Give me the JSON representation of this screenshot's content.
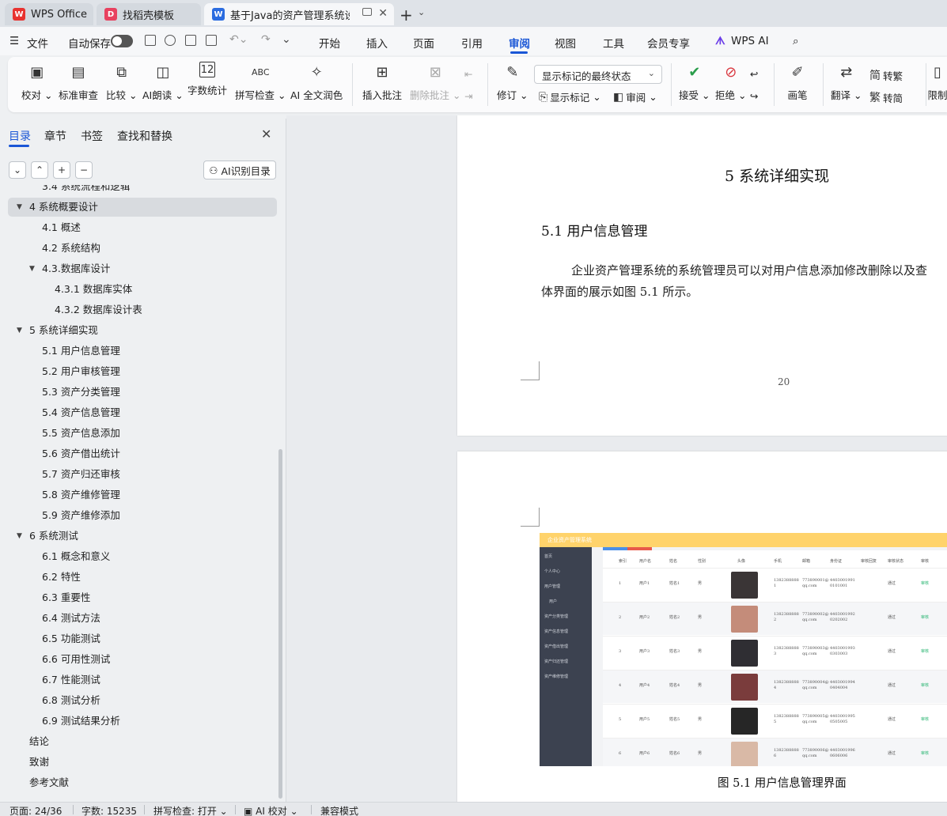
{
  "tabs": [
    {
      "label": "WPS Office",
      "icon": "wps-logo-icon",
      "color": "#e8322f"
    },
    {
      "label": "找稻壳模板",
      "icon": "docer-icon",
      "color": "#e8415f"
    },
    {
      "label": "基于Java的资产管理系统设计",
      "icon": "word-doc-icon",
      "color": "#2b6ce0"
    }
  ],
  "menu": {
    "file": "文件",
    "autosave": "自动保存",
    "items": [
      "开始",
      "插入",
      "页面",
      "引用",
      "审阅",
      "视图",
      "工具",
      "会员专享"
    ],
    "active": "审阅",
    "wps_ai": "WPS AI"
  },
  "ribbon": {
    "buttons": [
      {
        "label": "校对",
        "icon": "proofread-icon",
        "dropdown": true
      },
      {
        "label": "标准审查",
        "icon": "standard-review-icon",
        "dropdown": false
      },
      {
        "label": "比较",
        "icon": "compare-icon",
        "dropdown": true
      },
      {
        "label": "AI朗读",
        "icon": "ai-read-aloud-icon",
        "dropdown": true
      },
      {
        "label": "字数统计",
        "icon": "word-count-icon",
        "dropdown": false
      },
      {
        "label": "拼写检查",
        "icon": "spell-check-icon",
        "dropdown": true
      },
      {
        "label": "AI 全文润色",
        "icon": "ai-polish-icon",
        "dropdown": false
      },
      {
        "label": "插入批注",
        "icon": "insert-comment-icon",
        "dropdown": false
      },
      {
        "label": "删除批注",
        "icon": "delete-comment-icon",
        "dropdown": true,
        "disabled": true
      }
    ],
    "markup_state": "显示标记的最终状态",
    "track_changes": "修订",
    "show_markup": "显示标记",
    "review_pane": "审阅",
    "accept": "接受",
    "reject": "拒绝",
    "pen": "画笔",
    "translate": "翻译",
    "to_traditional": "转繁",
    "to_simplified": "转简",
    "restrict": "限制"
  },
  "navpane": {
    "tabs": [
      "目录",
      "章节",
      "书签",
      "查找和替换"
    ],
    "active_tab": "目录",
    "ai_toc": "AI识别目录",
    "items": [
      {
        "text": "3.4 系统流程和逻辑",
        "level": 2,
        "expand": ""
      },
      {
        "text": "4 系统概要设计",
        "level": 1,
        "expand": "▼",
        "selected": true
      },
      {
        "text": "4.1 概述",
        "level": 2,
        "expand": ""
      },
      {
        "text": "4.2 系统结构",
        "level": 2,
        "expand": ""
      },
      {
        "text": "4.3.数据库设计",
        "level": 2,
        "expand": "▼"
      },
      {
        "text": "4.3.1 数据库实体",
        "level": 3,
        "expand": ""
      },
      {
        "text": "4.3.2 数据库设计表",
        "level": 3,
        "expand": ""
      },
      {
        "text": "5 系统详细实现",
        "level": 1,
        "expand": "▼"
      },
      {
        "text": "5.1  用户信息管理",
        "level": 2,
        "expand": ""
      },
      {
        "text": "5.2  用户审核管理",
        "level": 2,
        "expand": ""
      },
      {
        "text": "5.3  资产分类管理",
        "level": 2,
        "expand": ""
      },
      {
        "text": "5.4  资产信息管理",
        "level": 2,
        "expand": ""
      },
      {
        "text": "5.5  资产信息添加",
        "level": 2,
        "expand": ""
      },
      {
        "text": "5.6  资产借出统计",
        "level": 2,
        "expand": ""
      },
      {
        "text": "5.7  资产归还审核",
        "level": 2,
        "expand": ""
      },
      {
        "text": "5.8  资产维修管理",
        "level": 2,
        "expand": ""
      },
      {
        "text": "5.9  资产维修添加",
        "level": 2,
        "expand": ""
      },
      {
        "text": "6 系统测试",
        "level": 1,
        "expand": "▼"
      },
      {
        "text": "6.1 概念和意义",
        "level": 2,
        "expand": ""
      },
      {
        "text": "6.2 特性",
        "level": 2,
        "expand": ""
      },
      {
        "text": "6.3 重要性",
        "level": 2,
        "expand": ""
      },
      {
        "text": "6.4 测试方法",
        "level": 2,
        "expand": ""
      },
      {
        "text": "6.5  功能测试",
        "level": 2,
        "expand": ""
      },
      {
        "text": "6.6 可用性测试",
        "level": 2,
        "expand": ""
      },
      {
        "text": "6.7 性能测试",
        "level": 2,
        "expand": ""
      },
      {
        "text": "6.8 测试分析",
        "level": 2,
        "expand": ""
      },
      {
        "text": "6.9 测试结果分析",
        "level": 2,
        "expand": ""
      },
      {
        "text": "结论",
        "level": 1,
        "expand": ""
      },
      {
        "text": "致谢",
        "level": 1,
        "expand": ""
      },
      {
        "text": "参考文献",
        "level": 1,
        "expand": ""
      }
    ]
  },
  "document": {
    "chapter_title": "5 系统详细实现",
    "section_title": "5.1  用户信息管理",
    "paragraph_line1": "企业资产管理系统的系统管理员可以对用户信息添加修改删除以及查",
    "paragraph_line2": "体界面的展示如图 5.1 所示。",
    "page_number": "20",
    "figure_caption": "图 5.1  用户信息管理界面",
    "screenshot": {
      "app_title": "企业资产管理系统",
      "side_menu": [
        "首页",
        "个人中心",
        "用户管理",
        "用户",
        "资产分类管理",
        "资产信息管理",
        "资产借出管理",
        "资产归还管理",
        "资产维修管理"
      ],
      "columns": [
        "索引",
        "用户名",
        "姓名",
        "性别",
        "头像",
        "手机",
        "邮箱",
        "身份证",
        "审核回复",
        "审核状态",
        "审核"
      ],
      "rows": [
        {
          "idx": "1",
          "user": "用户1",
          "name": "姓名1",
          "sex": "男",
          "phone": "13823888881",
          "email": "773890001@qq.com",
          "id": "44030019910101001",
          "status": "通过",
          "action": "审核"
        },
        {
          "idx": "2",
          "user": "用户2",
          "name": "姓名2",
          "sex": "男",
          "phone": "13823888882",
          "email": "773890002@qq.com",
          "id": "44030019920202002",
          "status": "通过",
          "action": "审核"
        },
        {
          "idx": "3",
          "user": "用户3",
          "name": "姓名3",
          "sex": "男",
          "phone": "13823888883",
          "email": "773890003@qq.com",
          "id": "44030019930303003",
          "status": "通过",
          "action": "审核"
        },
        {
          "idx": "4",
          "user": "用户4",
          "name": "姓名4",
          "sex": "男",
          "phone": "13823888884",
          "email": "773890004@qq.com",
          "id": "44030019940404004",
          "status": "通过",
          "action": "审核"
        },
        {
          "idx": "5",
          "user": "用户5",
          "name": "姓名5",
          "sex": "男",
          "phone": "13823888885",
          "email": "773890005@qq.com",
          "id": "44030019950505005",
          "status": "通过",
          "action": "审核"
        },
        {
          "idx": "6",
          "user": "用户6",
          "name": "姓名6",
          "sex": "男",
          "phone": "13823888886",
          "email": "773890006@qq.com",
          "id": "44030019960606006",
          "status": "通过",
          "action": "审核"
        }
      ],
      "header_color": "#ffd36b",
      "sidebar_color": "#3c4250"
    }
  },
  "status": {
    "page": "页面: 24/36",
    "words": "字数: 15235",
    "spell": "拼写检查: 打开",
    "ai_proof": "AI 校对",
    "compat": "兼容模式"
  }
}
